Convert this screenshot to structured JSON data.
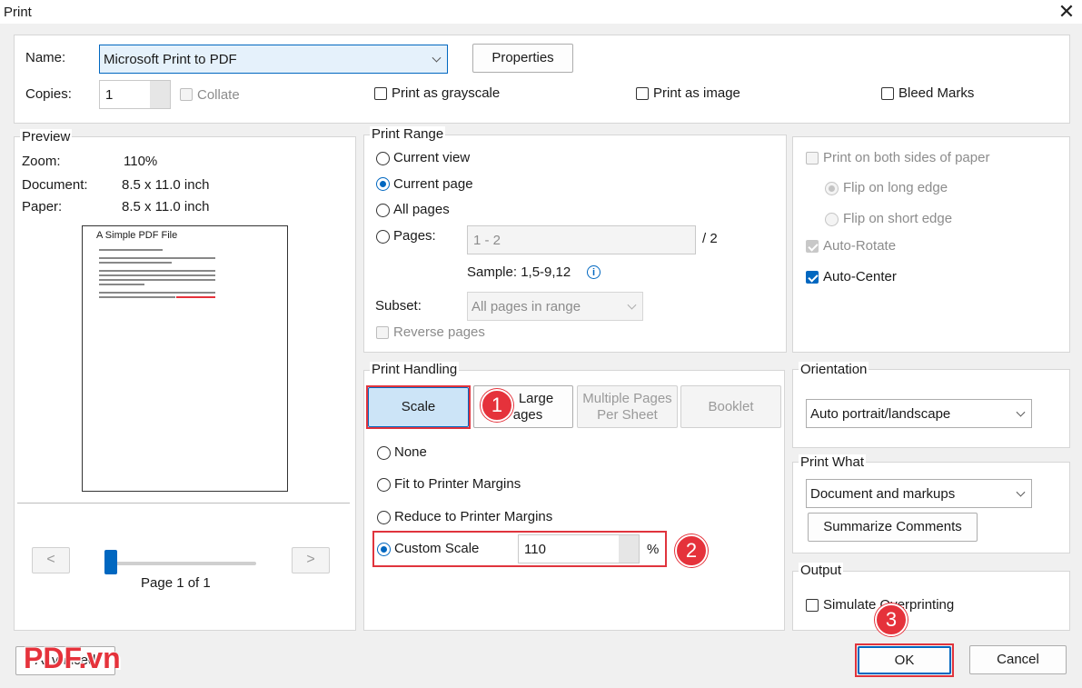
{
  "window": {
    "title": "Print"
  },
  "printer": {
    "name_label": "Name:",
    "name_value": "Microsoft Print to PDF",
    "properties_label": "Properties",
    "copies_label": "Copies:",
    "copies_value": "1",
    "collate_label": "Collate",
    "grayscale_label": "Print as grayscale",
    "image_label": "Print as image",
    "bleed_label": "Bleed Marks"
  },
  "preview": {
    "title": "Preview",
    "zoom_label": "Zoom:",
    "zoom_value": "110%",
    "document_label": "Document:",
    "document_value": "8.5 x 11.0 inch",
    "paper_label": "Paper:",
    "paper_value": "8.5 x 11.0 inch",
    "page_title": "A Simple PDF File",
    "prev_label": "<",
    "next_label": ">",
    "page_status": "Page 1 of 1",
    "page_progress": 0.0
  },
  "print_range": {
    "title": "Print Range",
    "current_view": "Current view",
    "current_page": "Current page",
    "all_pages": "All pages",
    "pages_label": "Pages:",
    "pages_value": "1 - 2",
    "pages_total": "/ 2",
    "sample": "Sample: 1,5-9,12",
    "subset_label": "Subset:",
    "subset_value": "All pages in range",
    "reverse_label": "Reverse pages"
  },
  "duplex": {
    "both_sides": "Print on both sides of paper",
    "long_edge": "Flip on long edge",
    "short_edge": "Flip on short edge",
    "auto_rotate": "Auto-Rotate",
    "auto_center": "Auto-Center"
  },
  "print_handling": {
    "title": "Print Handling",
    "tab_scale": "Scale",
    "tab_large_line1": "Large",
    "tab_large_line2": "ages",
    "tab_multiple_line1": "Multiple Pages",
    "tab_multiple_line2": "Per Sheet",
    "tab_booklet": "Booklet",
    "none": "None",
    "fit": "Fit to Printer Margins",
    "reduce": "Reduce to Printer Margins",
    "custom": "Custom Scale",
    "custom_value": "110",
    "percent": "%"
  },
  "orientation": {
    "title": "Orientation",
    "value": "Auto portrait/landscape"
  },
  "print_what": {
    "title": "Print What",
    "value": "Document and markups",
    "summarize_label": "Summarize Comments"
  },
  "output": {
    "title": "Output",
    "simulate_label": "Simulate Overprinting",
    "simulate_visible": "Simulate O",
    "simulate_tail": "verprinting"
  },
  "footer": {
    "advanced_label": "Advanced",
    "ok_label": "OK",
    "cancel_label": "Cancel"
  },
  "annotations": {
    "badge1": "1",
    "badge2": "2",
    "badge3": "3",
    "logo": "PDF.vn"
  },
  "colors": {
    "accent": "#0067c0",
    "highlight": "#e5323b",
    "dialog_bg": "#f0f0f0"
  }
}
